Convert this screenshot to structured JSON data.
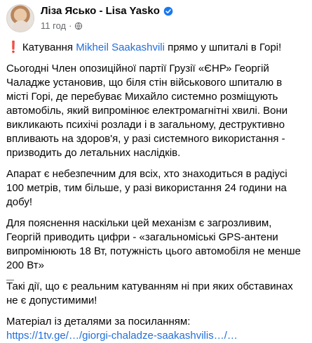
{
  "post": {
    "author": "Ліза Ясько - Lisa Yasko",
    "time": "11 год",
    "separator": "·",
    "verified_icon": "verified-badge-icon",
    "privacy_icon": "globe-icon"
  },
  "content": {
    "warning_icon": "❗",
    "headline_before": "Катування ",
    "mention": "Mikheil Saakashvili",
    "headline_after": " прямо у шпиталі в Горі!",
    "paragraph_2": "Сьогодні Член опозиційної партії Грузії «ЄНР» Георгій Чаладже установив, що біля стін військового шпиталю в місті Горі, де перебуває Михайло системно розміщують автомобіль, який випромінює електромагнітні хвилі. Вони викликають психічі розлади і в загальному, деструктивно впливають на здоров'я, у разі системного використання - призводить до летальних наслідків.",
    "paragraph_3": "Апарат є небезпечним для всіх, хто знаходиться в радіусі 100 метрів, тим більше, у разі використання 24 години на добу!",
    "paragraph_4": "Для пояснення наскільки цей механізм є загрозливим, Георгій приводить цифри - «загальноміські GPS-антени випромінюють 18 Вт, потужність цього автомобіля не менше 200 Вт»",
    "paragraph_5": "Такі дії, що є реальним катуванням ні при яких обставинах не є допустимими!",
    "paragraph_6": "Матеріал із деталями за посиланням:",
    "link": "https://1tv.ge/…/giorgi-chaladze-saakashvilis…/…"
  },
  "colors": {
    "text": "#050505",
    "secondary": "#65676b",
    "link": "#216fdb",
    "verified": "#1877f2",
    "warning": "#e41e3f"
  }
}
